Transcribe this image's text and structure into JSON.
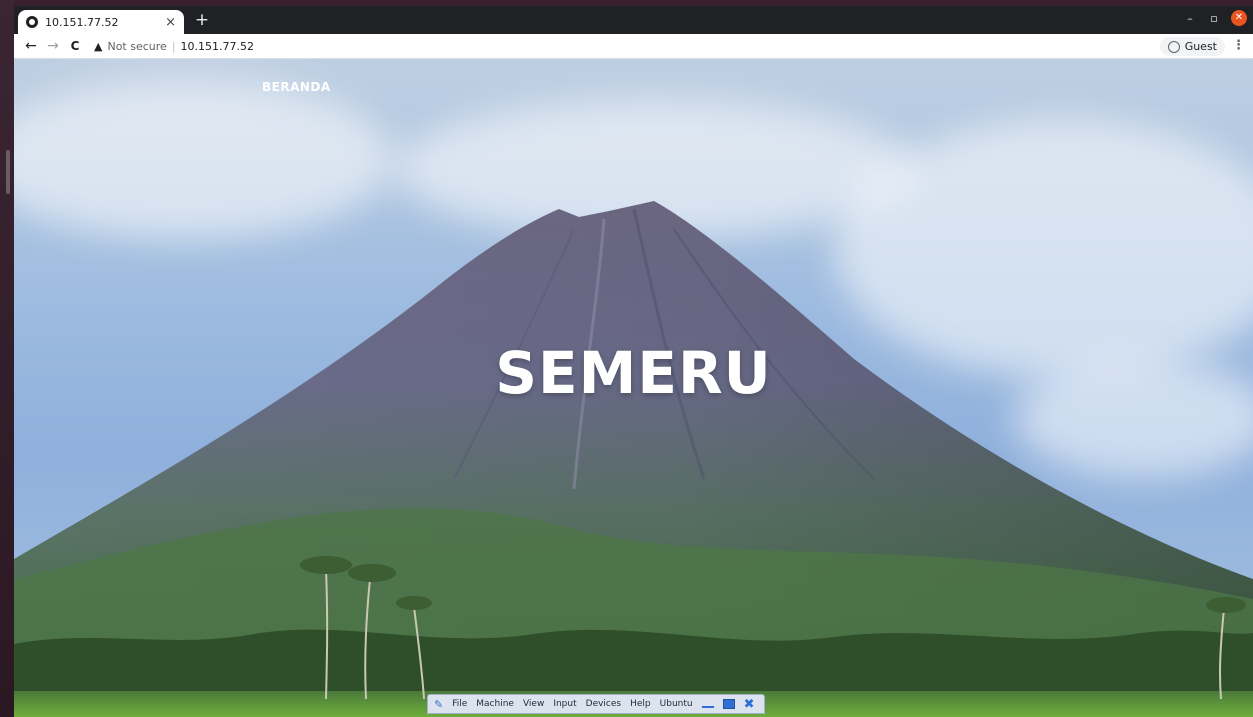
{
  "browser": {
    "tab_title": "10.151.77.52",
    "tab_close": "×",
    "new_tab": "+",
    "window_min": "–",
    "window_max": "▫",
    "window_close": "✕",
    "back": "←",
    "forward": "→",
    "reload": "C",
    "security_warning": "▲",
    "not_secure": "Not secure",
    "separator": "|",
    "url": "10.151.77.52",
    "profile_label": "Guest",
    "menu": "⋮"
  },
  "page": {
    "nav_link": "BERANDA",
    "hero_title": "SEMERU"
  },
  "vm_bar": {
    "items": [
      "File",
      "Machine",
      "View",
      "Input",
      "Devices",
      "Help"
    ],
    "vm_name": "Ubuntu"
  },
  "colors": {
    "tabstrip": "#202124",
    "close_button": "#e95420",
    "hero_text": "#ffffff"
  }
}
